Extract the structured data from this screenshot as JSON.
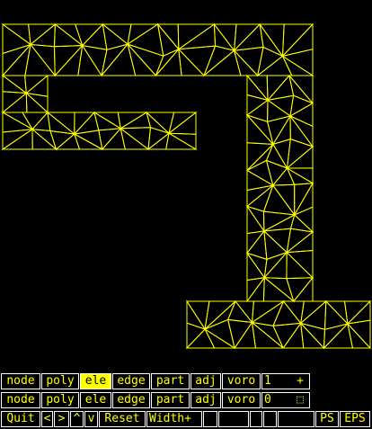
{
  "rows": [
    {
      "buttons": [
        "node",
        "poly",
        "ele",
        "edge",
        "part",
        "adj",
        "voro"
      ],
      "selected": 2,
      "number": "1",
      "icon_glyph": "+"
    },
    {
      "buttons": [
        "node",
        "poly",
        "ele",
        "edge",
        "part",
        "adj",
        "voro"
      ],
      "selected": -1,
      "number": "0",
      "icon_glyph": "⬚"
    }
  ],
  "controls": {
    "quit": "Quit",
    "left": "<",
    "right": ">",
    "up": "^",
    "down": "v",
    "reset": "Reset",
    "width_plus": "Width+",
    "ps": "PS",
    "eps": "EPS"
  },
  "colors": {
    "mesh": "#ffff00",
    "background": "#000000",
    "border": "#ffffff"
  }
}
